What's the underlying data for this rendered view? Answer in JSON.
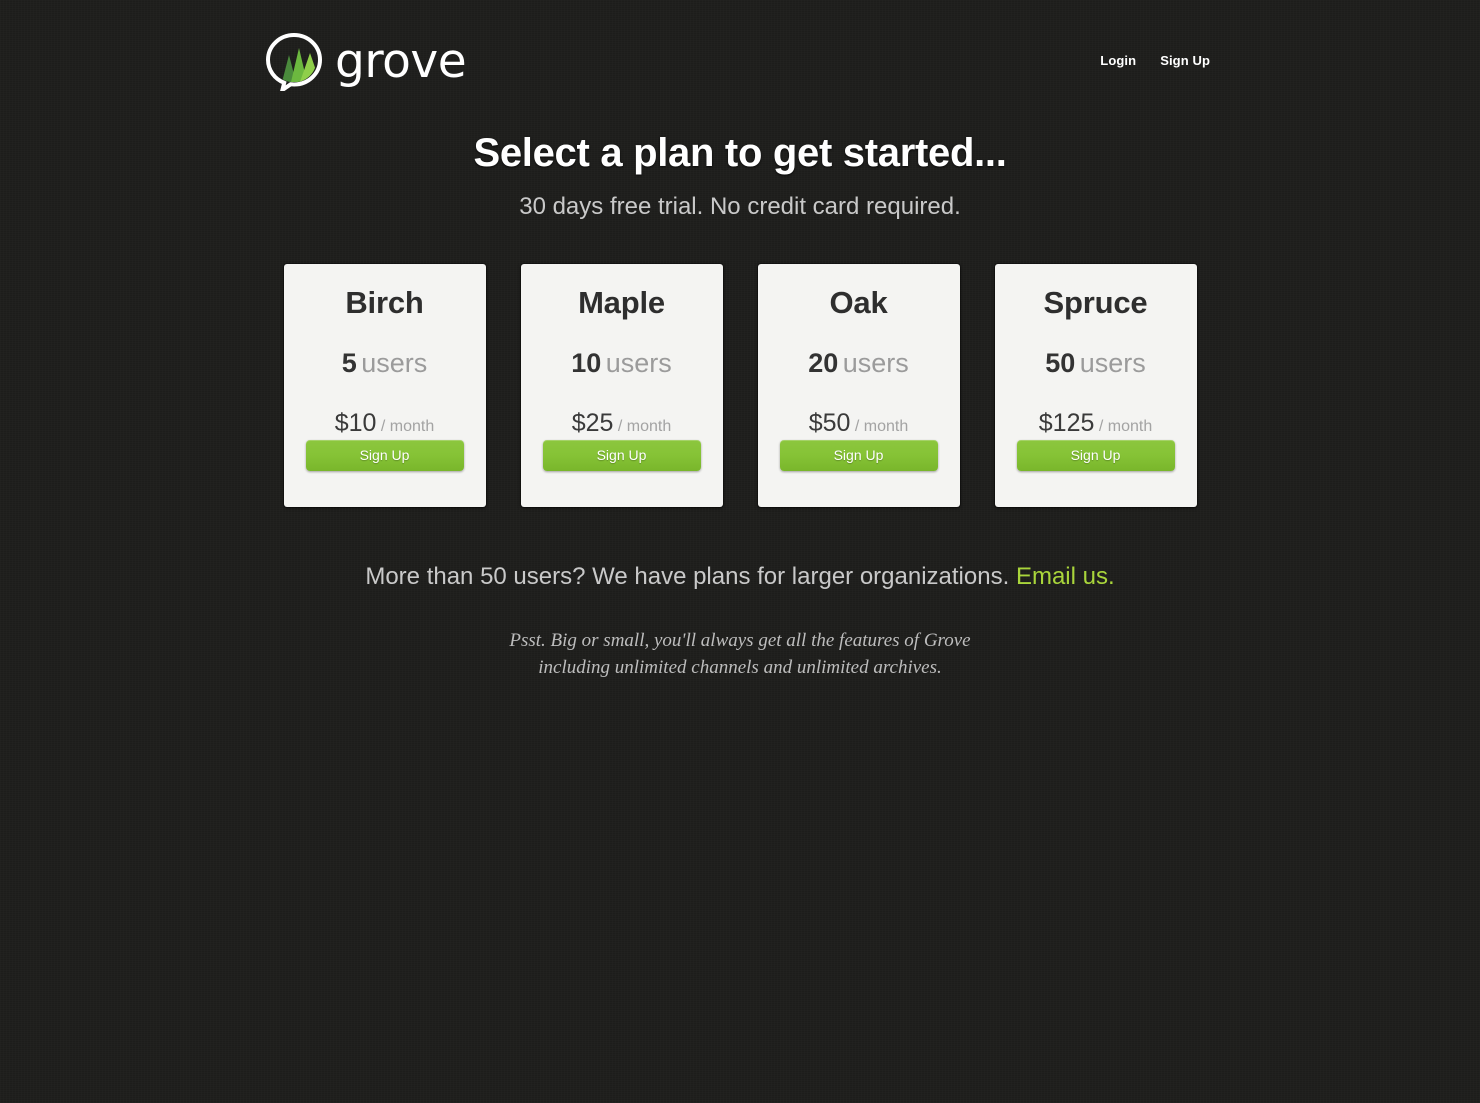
{
  "brand": {
    "name": "grove",
    "logo_icon": "grove-trees-bubble-logo",
    "logo_colors": {
      "dark_green": "#4a8a3c",
      "mid_green": "#6cb83f",
      "light_green": "#8fcf4a",
      "ring": "#ffffff"
    }
  },
  "nav": {
    "login_label": "Login",
    "signup_label": "Sign Up"
  },
  "hero": {
    "title": "Select a plan to get started...",
    "subtitle": "30 days free trial. No credit card required."
  },
  "plans": [
    {
      "name": "Birch",
      "users_count": "5",
      "users_label": "users",
      "price": "$10",
      "period": "/ month",
      "cta_label": "Sign Up"
    },
    {
      "name": "Maple",
      "users_count": "10",
      "users_label": "users",
      "price": "$25",
      "period": "/ month",
      "cta_label": "Sign Up"
    },
    {
      "name": "Oak",
      "users_count": "20",
      "users_label": "users",
      "price": "$50",
      "period": "/ month",
      "cta_label": "Sign Up"
    },
    {
      "name": "Spruce",
      "users_count": "50",
      "users_label": "users",
      "price": "$125",
      "period": "/ month",
      "cta_label": "Sign Up"
    }
  ],
  "upsell": {
    "text": "More than 50 users? We have plans for larger organizations.",
    "link_label": "Email us."
  },
  "psst": {
    "line1": "Psst. Big or small, you'll always get all the features of Grove",
    "line2": "including unlimited channels and unlimited archives."
  },
  "colors": {
    "background": "#1d1d1b",
    "card": "#f4f4f2",
    "accent_green": "#86c336",
    "link_green": "#a9d53b"
  }
}
